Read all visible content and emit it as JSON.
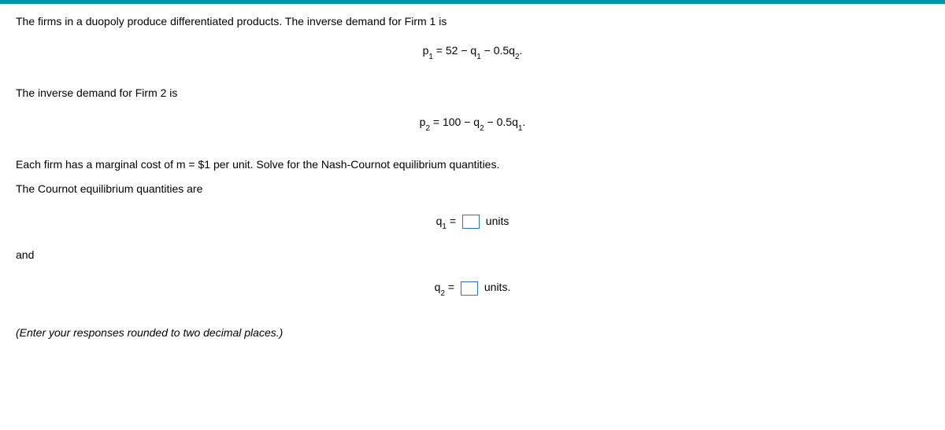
{
  "problem": {
    "intro": "The firms in a duopoly produce differentiated products.  The inverse demand for Firm 1 is",
    "eq1_p": "p",
    "eq1_sub1": "1",
    "eq1_mid": " = 52 − q",
    "eq1_sub2": "1",
    "eq1_mid2": " − 0.5q",
    "eq1_sub3": "2",
    "eq1_end": ".",
    "firm2_intro": "The inverse demand for Firm 2 is",
    "eq2_p": "p",
    "eq2_sub1": "2",
    "eq2_mid": " = 100 − q",
    "eq2_sub2": "2",
    "eq2_mid2": " − 0.5q",
    "eq2_sub3": "1",
    "eq2_end": ".",
    "mc_line": "Each firm has a marginal cost of m = $1 per unit.   Solve for the Nash-Cournot equilibrium quantities.",
    "eq_quant_line": "The Cournot equilibrium quantities are",
    "q1_var": "q",
    "q1_sub": "1",
    "q1_eq": " = ",
    "q1_units": " units",
    "and_text": "and",
    "q2_var": "q",
    "q2_sub": "2",
    "q2_eq": " = ",
    "q2_units": " units.",
    "instruction": "(Enter your responses rounded to two decimal places.)"
  }
}
